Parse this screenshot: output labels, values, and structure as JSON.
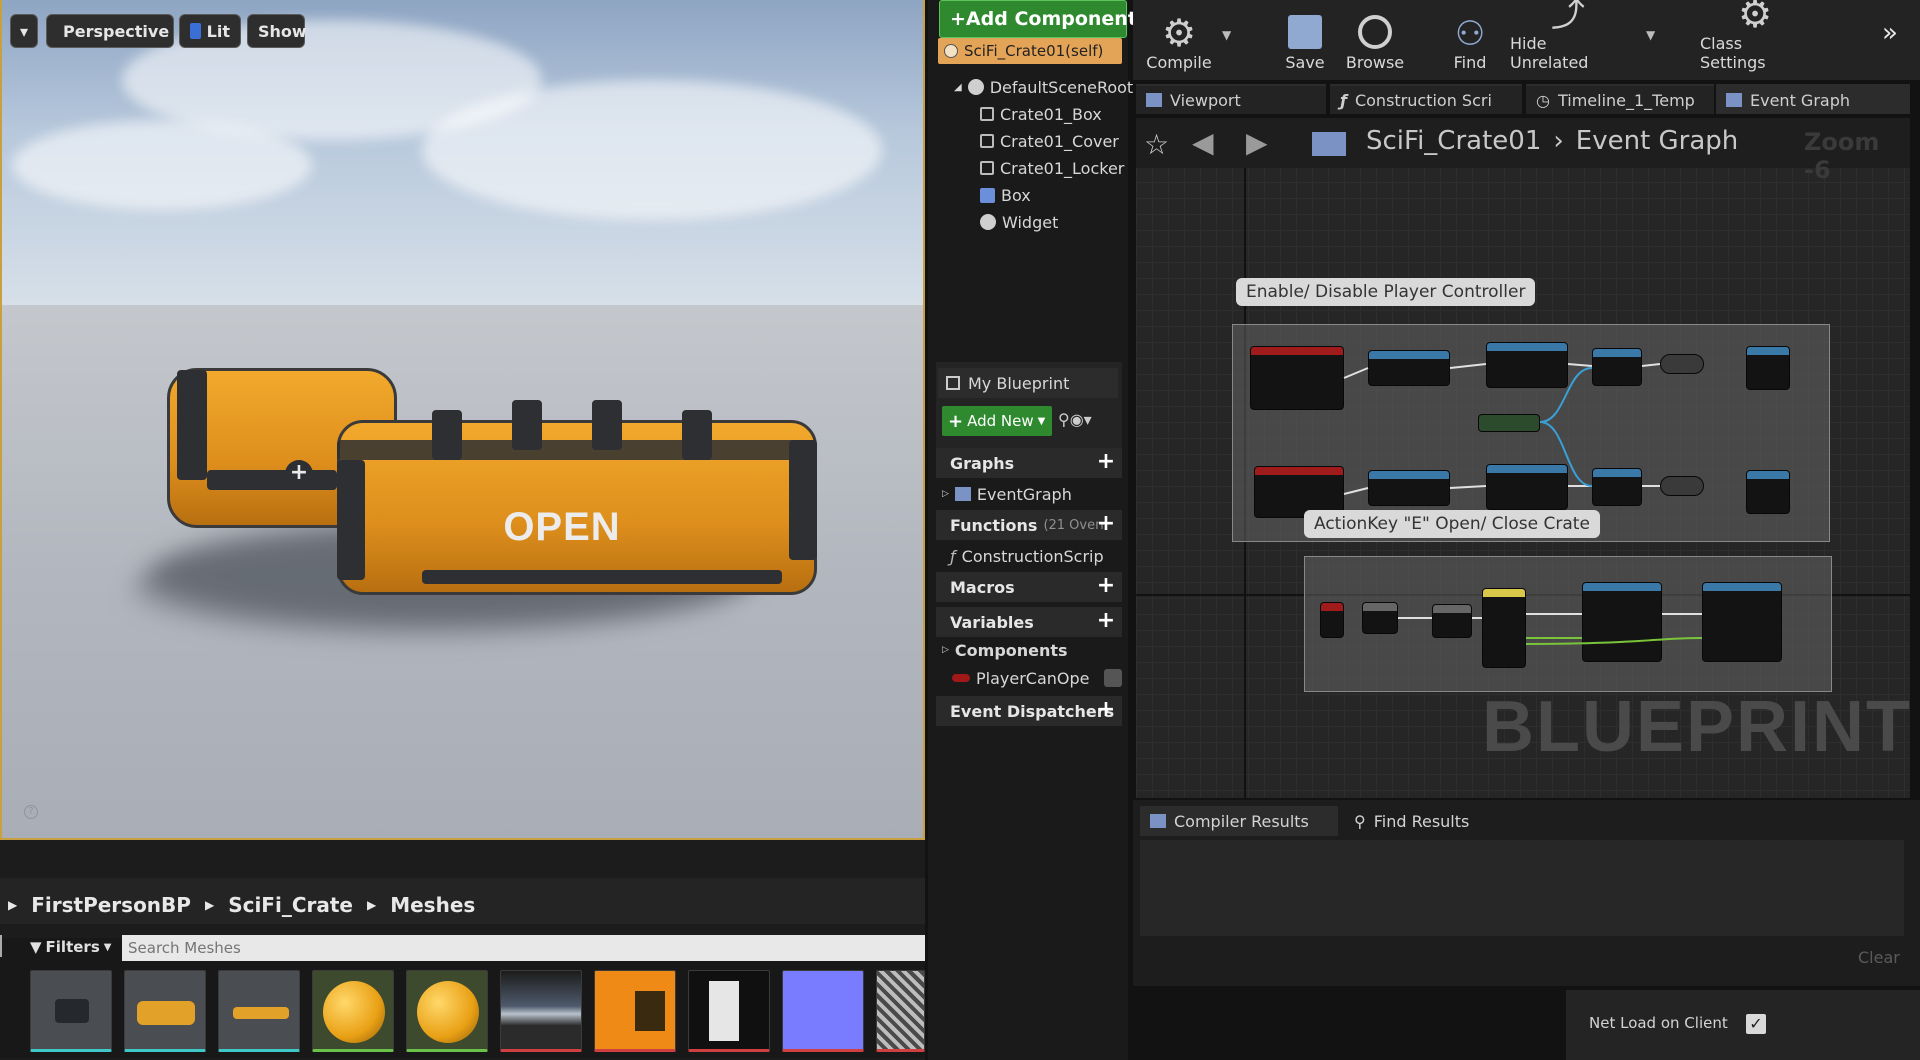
{
  "viewport": {
    "dropdown_label": "▾",
    "perspective_label": "Perspective",
    "lit_label": "Lit",
    "show_label": "Show",
    "crate_text": "OPEN"
  },
  "content_browser": {
    "breadcrumb": [
      "FirstPersonBP",
      "SciFi_Crate",
      "Meshes"
    ],
    "filters_label": "Filters",
    "search_placeholder": "Search Meshes",
    "thumbnails": [
      "mesh-tripod",
      "mesh-crate",
      "mesh-lid",
      "material-ball-1",
      "material-ball-2",
      "texture-sky",
      "texture-orange",
      "texture-mask",
      "texture-normal",
      "texture-noise"
    ]
  },
  "components": {
    "add_component_label": "+Add Component",
    "self_label": "SciFi_Crate01(self)",
    "tree": [
      {
        "label": "DefaultSceneRoot",
        "icon": "scene-root-icon"
      },
      {
        "label": "Crate01_Box",
        "icon": "mesh-icon"
      },
      {
        "label": "Crate01_Cover",
        "icon": "mesh-icon"
      },
      {
        "label": "Crate01_Locker",
        "icon": "mesh-icon"
      },
      {
        "label": "Box",
        "icon": "box-collision-icon"
      },
      {
        "label": "Widget",
        "icon": "widget-icon"
      }
    ]
  },
  "my_blueprint": {
    "tab_label": "My Blueprint",
    "add_new_label": "Add New",
    "sections": [
      {
        "label": "Graphs"
      },
      {
        "label": "EventGraph",
        "child": true
      },
      {
        "label": "Functions",
        "extra": "(21 Overr"
      },
      {
        "label": "ConstructionScrip",
        "child": true
      },
      {
        "label": "Macros"
      },
      {
        "label": "Variables"
      },
      {
        "label": "Components",
        "child": true
      },
      {
        "label": "PlayerCanOpe",
        "child": true
      },
      {
        "label": "Event Dispatchers"
      }
    ]
  },
  "toolbar": {
    "compile": "Compile",
    "save": "Save",
    "browse": "Browse",
    "find": "Find",
    "hide_unrelated": "Hide Unrelated",
    "class_settings": "Class Settings"
  },
  "tabs": [
    "Viewport",
    "Construction Scri",
    "Timeline_1_Temp",
    "Event Graph"
  ],
  "graph": {
    "breadcrumb_root": "SciFi_Crate01",
    "breadcrumb_leaf": "Event Graph",
    "zoom": "Zoom -6",
    "comment1": "Enable/ Disable Player Controller",
    "comment2": "ActionKey \"E\" Open/ Close Crate",
    "watermark": "BLUEPRINT"
  },
  "results": {
    "tab1": "Compiler Results",
    "tab2": "Find Results",
    "clear": "Clear"
  },
  "details": {
    "net_load_label": "Net Load on Client",
    "net_load_checked": true
  },
  "colors": {
    "accent_orange": "#e5a02a",
    "add_green": "#3a9a3a",
    "graph_bg": "#262626"
  }
}
